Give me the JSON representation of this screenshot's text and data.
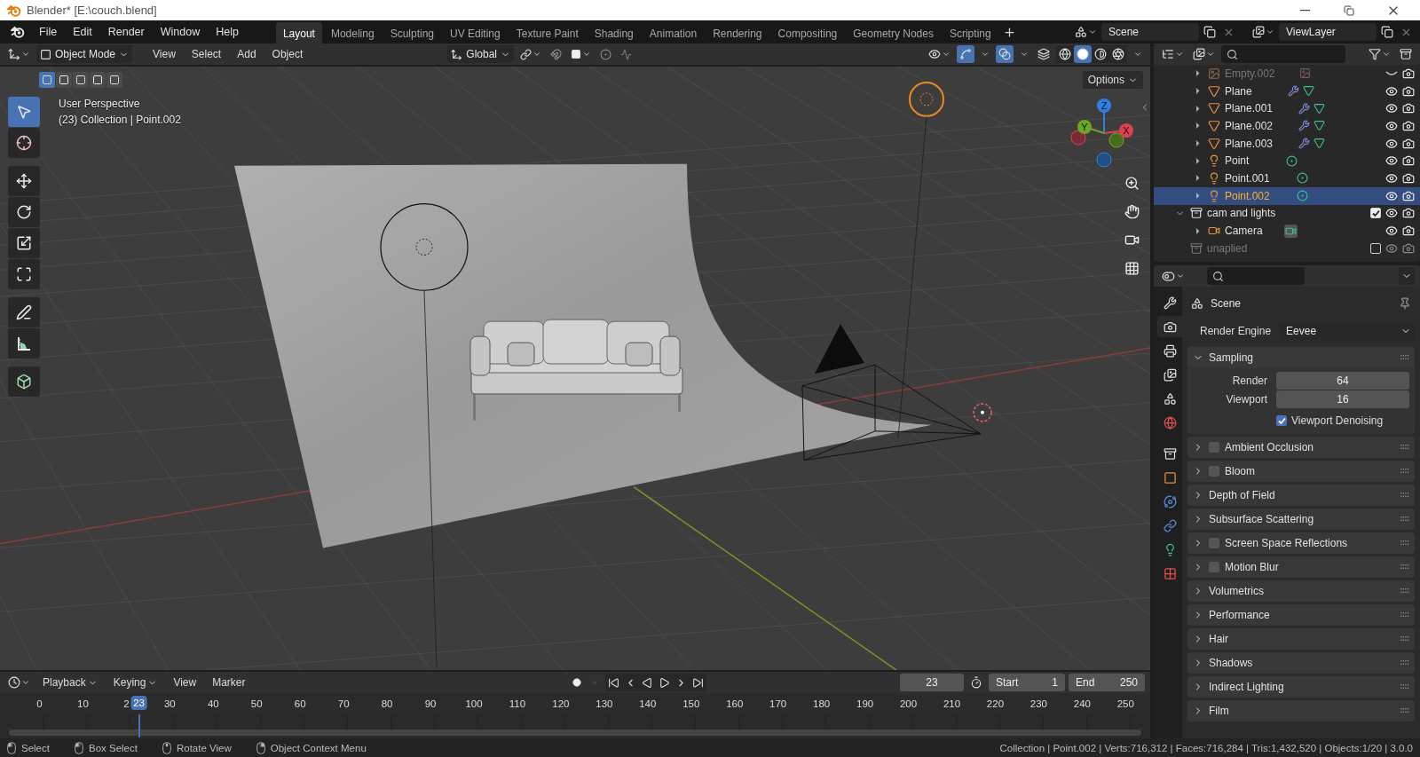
{
  "window": {
    "title": "Blender* [E:\\couch.blend]"
  },
  "menu": [
    "File",
    "Edit",
    "Render",
    "Window",
    "Help"
  ],
  "workspaces": [
    {
      "label": "Layout",
      "selected": true
    },
    {
      "label": "Modeling",
      "selected": false
    },
    {
      "label": "Sculpting",
      "selected": false
    },
    {
      "label": "UV Editing",
      "selected": false
    },
    {
      "label": "Texture Paint",
      "selected": false
    },
    {
      "label": "Shading",
      "selected": false
    },
    {
      "label": "Animation",
      "selected": false
    },
    {
      "label": "Rendering",
      "selected": false
    },
    {
      "label": "Compositing",
      "selected": false
    },
    {
      "label": "Geometry Nodes",
      "selected": false
    },
    {
      "label": "Scripting",
      "selected": false
    }
  ],
  "scene": {
    "name": "Scene"
  },
  "view_layer": {
    "name": "ViewLayer"
  },
  "viewport": {
    "mode": "Object Mode",
    "menus": [
      "View",
      "Select",
      "Add",
      "Object"
    ],
    "orientation": "Global",
    "options": "Options",
    "snap": {
      "on": false
    },
    "proportional": {
      "on": false
    },
    "gizmos": {
      "on": true
    },
    "overlays": {
      "on": true
    },
    "xray": {
      "on": false
    },
    "shading": [
      {
        "kind": "wireframe",
        "selected": false
      },
      {
        "kind": "solid",
        "selected": true
      },
      {
        "kind": "material",
        "selected": false
      },
      {
        "kind": "rendered",
        "selected": false
      }
    ],
    "select_modes": [
      {
        "selected": true
      },
      {
        "selected": false
      },
      {
        "selected": false
      },
      {
        "selected": false
      },
      {
        "selected": false
      }
    ],
    "info": [
      "User Perspective",
      "(23) Collection | Point.002"
    ],
    "tools": [
      {
        "kind": "select",
        "selected": true
      },
      {
        "kind": "cursor",
        "selected": false
      },
      {
        "kind": "move",
        "selected": false
      },
      {
        "kind": "rotate",
        "selected": false
      },
      {
        "kind": "scale",
        "selected": false
      },
      {
        "kind": "transform",
        "selected": false
      },
      {
        "kind": "annotate",
        "selected": false
      },
      {
        "kind": "measure",
        "selected": false
      },
      {
        "kind": "add_cube",
        "selected": false
      }
    ],
    "gizmo_axes": [
      "Z",
      "Y",
      "X"
    ]
  },
  "outliner": {
    "rows": [
      {
        "name": "Empty.002",
        "kind": "empty",
        "visible": false,
        "selected": false
      },
      {
        "name": "Plane",
        "kind": "mesh",
        "visible": true,
        "selected": false
      },
      {
        "name": "Plane.001",
        "kind": "mesh",
        "visible": true,
        "selected": false
      },
      {
        "name": "Plane.002",
        "kind": "mesh",
        "visible": true,
        "selected": false
      },
      {
        "name": "Plane.003",
        "kind": "mesh",
        "visible": true,
        "selected": false
      },
      {
        "name": "Point",
        "kind": "light",
        "visible": true,
        "selected": false
      },
      {
        "name": "Point.001",
        "kind": "light",
        "visible": true,
        "selected": false
      },
      {
        "name": "Point.002",
        "kind": "light",
        "visible": true,
        "selected": true
      }
    ],
    "collections": [
      {
        "name": "cam and lights",
        "expanded": true,
        "checked": true,
        "disabled": false,
        "children": [
          {
            "name": "Camera",
            "kind": "camera",
            "visible": true,
            "selected": false
          }
        ]
      },
      {
        "name": "unaplied",
        "expanded": false,
        "checked": false,
        "disabled": true
      }
    ]
  },
  "properties": {
    "tabs": [
      {
        "kind": "tool",
        "selected": false
      },
      {
        "kind": "render",
        "selected": true
      },
      {
        "kind": "output",
        "selected": false
      },
      {
        "kind": "view_layer",
        "selected": false
      },
      {
        "kind": "scene",
        "selected": false
      },
      {
        "kind": "world",
        "selected": false
      },
      {
        "kind": "collection",
        "selected": false
      },
      {
        "kind": "object",
        "selected": false
      },
      {
        "kind": "physics",
        "selected": false
      },
      {
        "kind": "constraints",
        "selected": false
      },
      {
        "kind": "data",
        "selected": false
      },
      {
        "kind": "texture",
        "selected": false
      }
    ],
    "context": "Scene",
    "engine_label": "Render Engine",
    "engine": "Eevee",
    "sampling": {
      "title": "Sampling",
      "expanded": true,
      "fields": [
        {
          "label": "Render",
          "value": "64"
        },
        {
          "label": "Viewport",
          "value": "16"
        }
      ],
      "denoising": {
        "label": "Viewport Denoising",
        "checked": true
      }
    },
    "panels": [
      {
        "title": "Ambient Occlusion",
        "kind": "toggle",
        "checked": false
      },
      {
        "title": "Bloom",
        "kind": "toggle",
        "checked": false
      },
      {
        "title": "Depth of Field",
        "kind": "plain"
      },
      {
        "title": "Subsurface Scattering",
        "kind": "plain"
      },
      {
        "title": "Screen Space Reflections",
        "kind": "toggle",
        "checked": false
      },
      {
        "title": "Motion Blur",
        "kind": "toggle",
        "checked": false
      },
      {
        "title": "Volumetrics",
        "kind": "plain"
      },
      {
        "title": "Performance",
        "kind": "plain"
      },
      {
        "title": "Hair",
        "kind": "plain"
      },
      {
        "title": "Shadows",
        "kind": "plain"
      },
      {
        "title": "Indirect Lighting",
        "kind": "plain"
      },
      {
        "title": "Film",
        "kind": "plain"
      }
    ]
  },
  "timeline": {
    "menus": [
      {
        "label": "Playback",
        "dropdown": true
      },
      {
        "label": "Keying",
        "dropdown": true
      },
      {
        "label": "View",
        "dropdown": false
      },
      {
        "label": "Marker",
        "dropdown": false
      }
    ],
    "current_frame": "23",
    "start": {
      "label": "Start",
      "value": "1"
    },
    "end": {
      "label": "End",
      "value": "250"
    },
    "ticks": [
      "0",
      "10",
      "2",
      "30",
      "40",
      "50",
      "60",
      "70",
      "80",
      "90",
      "100",
      "110",
      "120",
      "130",
      "140",
      "150",
      "160",
      "170",
      "180",
      "190",
      "200",
      "210",
      "220",
      "230",
      "240",
      "250"
    ],
    "playhead": {
      "label": "23",
      "level": 0.092
    }
  },
  "status_bar": {
    "hints": [
      {
        "kind": "left",
        "label": "Select"
      },
      {
        "kind": "left",
        "label": "Box Select"
      },
      {
        "kind": "middle",
        "label": "Rotate View"
      },
      {
        "kind": "right",
        "label": "Object Context Menu"
      }
    ],
    "stats": "Collection | Point.002 | Verts:716,312 | Faces:716,284 | Tris:1,432,520 | Objects:1/20 | 3.0.0"
  }
}
